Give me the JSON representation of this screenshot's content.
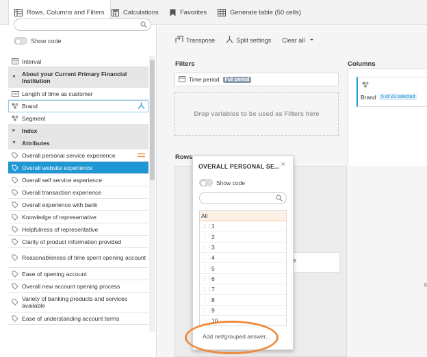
{
  "tabs": [
    {
      "label": "Rows, Columns and Filters",
      "icon": "rows-columns-icon",
      "active": true
    },
    {
      "label": "Calculations",
      "icon": "calculator-icon",
      "active": false
    },
    {
      "label": "Favorites",
      "icon": "bookmark-icon",
      "active": false
    },
    {
      "label": "Generate table (50 cells)",
      "icon": "table-icon",
      "active": false
    }
  ],
  "sidebar": {
    "search_placeholder": "",
    "show_code_label": "Show code",
    "items": [
      {
        "label": "Interval",
        "type": "item",
        "icon": "calendar-icon"
      },
      {
        "label": "About your Current Primary Financial Institution",
        "type": "section",
        "expanded": true
      },
      {
        "label": "Length of time as customer",
        "type": "item",
        "icon": "numeric-icon"
      },
      {
        "label": "Brand",
        "type": "item",
        "icon": "categorical-icon",
        "state": "outlined",
        "right_icon": "split-icon"
      },
      {
        "label": "Segment",
        "type": "item",
        "icon": "categorical-icon"
      },
      {
        "label": "Index",
        "type": "section",
        "expanded": false
      },
      {
        "label": "Attributes",
        "type": "section",
        "expanded": true
      },
      {
        "label": "Overall personal service experience",
        "type": "item",
        "icon": "tag-icon",
        "right_icon": "drag-handle-icon"
      },
      {
        "label": "Overall website experience",
        "type": "item",
        "icon": "tag-icon",
        "state": "selected"
      },
      {
        "label": "Overall self service experience",
        "type": "item",
        "icon": "tag-icon"
      },
      {
        "label": "Overall transaction experience",
        "type": "item",
        "icon": "tag-icon"
      },
      {
        "label": "Overall experience with bank",
        "type": "item",
        "icon": "tag-icon"
      },
      {
        "label": "Knowledge of representative",
        "type": "item",
        "icon": "tag-icon"
      },
      {
        "label": "Helpfulness of representative",
        "type": "item",
        "icon": "tag-icon"
      },
      {
        "label": "Clarity of product information provided",
        "type": "item",
        "icon": "tag-icon"
      },
      {
        "label": "Reasonableness of time spent opening account",
        "type": "item",
        "icon": "tag-icon"
      },
      {
        "label": "Ease of opening account",
        "type": "item",
        "icon": "tag-icon"
      },
      {
        "label": "Overall new account opening process",
        "type": "item",
        "icon": "tag-icon"
      },
      {
        "label": "Variety of banking products and services available",
        "type": "item",
        "icon": "tag-icon"
      },
      {
        "label": "Ease of understanding account terms",
        "type": "item",
        "icon": "tag-icon"
      }
    ]
  },
  "toolbar": {
    "transpose_label": "Transpose",
    "split_label": "Split settings",
    "clear_label": "Clear all",
    "more_label": "•••"
  },
  "filters": {
    "heading": "Filters",
    "chip_label": "Time period",
    "chip_badge": "Full period",
    "drop_hint": "Drop variables to be used as Filters here"
  },
  "columns": {
    "heading": "Columns",
    "card_label": "Brand",
    "card_badge": "5 of 23 selected"
  },
  "rows": {
    "heading": "Rows",
    "row_card_text": "e",
    "partial_text": "N"
  },
  "popup": {
    "title": "OVERALL PERSONAL SE...",
    "close": "×",
    "show_code_label": "Show code",
    "search_placeholder": "",
    "items": [
      "All",
      "1",
      "2",
      "3",
      "4",
      "5",
      "6",
      "7",
      "8",
      "9",
      "10"
    ],
    "add_net_label": "Add net/grouped answer..."
  },
  "colors": {
    "accent": "#1f97d4",
    "highlight": "#ee8a3c",
    "selected_row": "#1f97d4"
  }
}
